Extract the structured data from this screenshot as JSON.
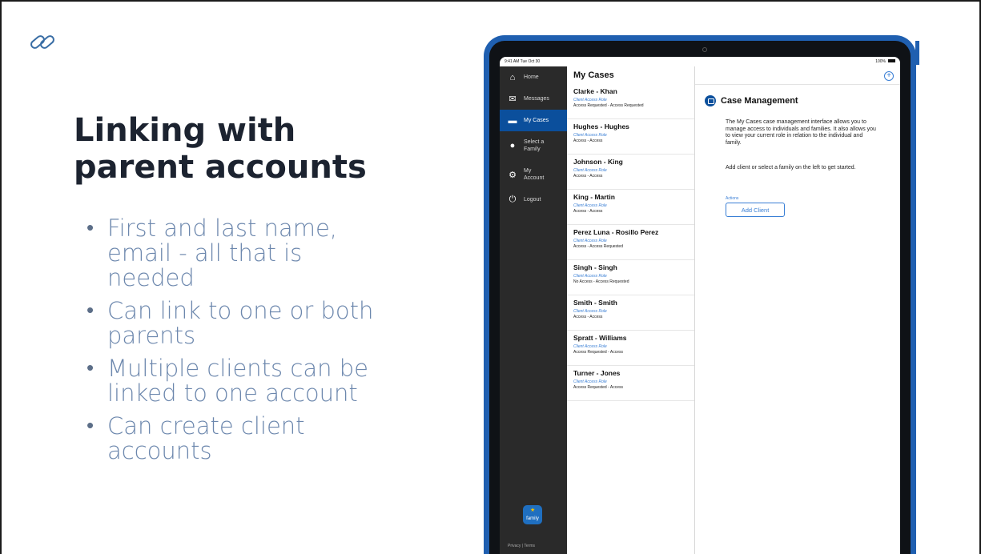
{
  "slide": {
    "title_line1": "Linking with",
    "title_line2": "parent accounts",
    "bullets": [
      {
        "line1": "First and last name,",
        "line2": "email - all that is",
        "line3": "needed"
      },
      {
        "line1": "Can link to one or both",
        "line2": "parents"
      },
      {
        "line1": "Multiple clients can be",
        "line2": "linked to one account"
      },
      {
        "line1": "Can create client",
        "line2": "accounts"
      }
    ]
  },
  "tablet": {
    "status": {
      "time": "9:41 AM  Tue Oct 30",
      "battery": "100%"
    },
    "sidebar": {
      "items": [
        {
          "label": "Home",
          "icon": "home-icon"
        },
        {
          "label": "Messages",
          "icon": "envelope-icon"
        },
        {
          "label": "My Cases",
          "icon": "briefcase-icon"
        },
        {
          "label_line1": "Select a",
          "label_line2": "Family",
          "icon": "person-icon"
        },
        {
          "label_line1": "My",
          "label_line2": "Account",
          "icon": "gear-icon"
        },
        {
          "label": "Logout",
          "icon": "power-icon"
        }
      ],
      "logo_text": "family",
      "footer": "Privacy  |  Terms"
    },
    "cases": {
      "header": "My Cases",
      "items": [
        {
          "name": "Clarke - Khan",
          "role": "Client Access Role",
          "access": "Access Requested - Access Requested"
        },
        {
          "name": "Hughes - Hughes",
          "role": "Client Access Role",
          "access": "Access - Access"
        },
        {
          "name": "Johnson - King",
          "role": "Client Access Role",
          "access": "Access - Access"
        },
        {
          "name": "King - Martin",
          "role": "Client Access Role",
          "access": "Access - Access"
        },
        {
          "name": "Perez Luna - Rosillo Perez",
          "role": "Client Access Role",
          "access": "Access - Access Requested"
        },
        {
          "name": "Singh - Singh",
          "role": "Client Access Role",
          "access": "No Access - Access Requested"
        },
        {
          "name": "Smith - Smith",
          "role": "Client Access Role",
          "access": "Access - Access"
        },
        {
          "name": "Spratt - Williams",
          "role": "Client Access Role",
          "access": "Access Requested - Access"
        },
        {
          "name": "Turner - Jones",
          "role": "Client Access Role",
          "access": "Access Requested - Access"
        }
      ]
    },
    "detail": {
      "plus": "+",
      "title": "Case Management",
      "description": "The My Cases case management interface allows you to manage access to individuals and families.  It also allows you to view your current role in relation to the individual and family.",
      "instruction": "Add client or select a family on the left to get started.",
      "actions_label": "Actions",
      "add_client_label": "Add Client"
    }
  }
}
